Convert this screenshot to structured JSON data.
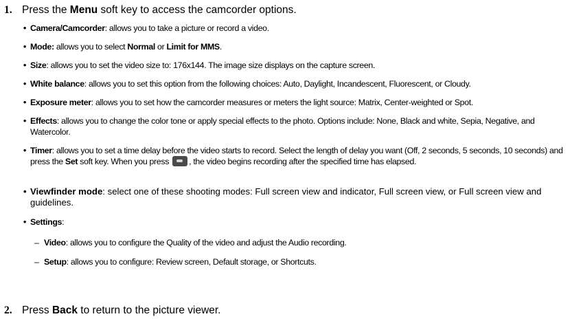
{
  "steps": [
    {
      "num": "1.",
      "before": "Press the ",
      "bold": "Menu",
      "after": " soft key to access the camcorder options."
    },
    {
      "num": "2.",
      "before": "Press ",
      "bold": "Back",
      "after": " to return to the picture viewer."
    }
  ],
  "bullets": {
    "camera": {
      "term": "Camera/Camcorder",
      "text": ": allows you to take a picture or record a video."
    },
    "mode": {
      "term": "Mode:",
      "t1": " allows you to select ",
      "b1": "Normal",
      "t2": " or ",
      "b2": "Limit for MMS",
      "t3": "."
    },
    "size": {
      "term": "Size",
      "text": ": allows you to set the video size to: 176x144. The image size displays on the capture screen."
    },
    "white_balance": {
      "term": "White balance",
      "text": ": allows you to set this option from the following choices: Auto, Daylight, Incandescent, Fluorescent, or Cloudy."
    },
    "exposure": {
      "term": "Exposure meter",
      "text": ": allows you to set how the camcorder measures or meters the light source: Matrix, Center-weighted or Spot."
    },
    "effects": {
      "term": "Effects",
      "text": ": allows you to change the color tone or apply special effects to the photo. Options include: None, Black and white, Sepia, Negative, and Watercolor."
    },
    "timer": {
      "term": "Timer",
      "t1": ": allows you to set a time delay before the video starts to record. Select the length of delay you want (Off, 2 seconds, 5 seconds, 10 seconds) and press the ",
      "b1": "Set",
      "t2": " soft key. When you press ",
      "t3": ", the video begins recording after the specified time has elapsed.",
      "key_icon": "ok-key-icon"
    },
    "viewfinder": {
      "term": "Viewfinder mode",
      "text": ": select one of these shooting modes: Full screen view and indicator, Full screen view, or Full screen view and guidelines."
    },
    "settings": {
      "term": "Settings",
      "text": ":"
    }
  },
  "settings_sub": [
    {
      "dash": "–",
      "term": "Video",
      "text": ": allows you to configure the Quality of the video and adjust the Audio recording."
    },
    {
      "dash": "–",
      "term": "Setup",
      "text": ": allows you to configure: Review screen, Default storage, or Shortcuts."
    }
  ],
  "bullet_char": "•"
}
